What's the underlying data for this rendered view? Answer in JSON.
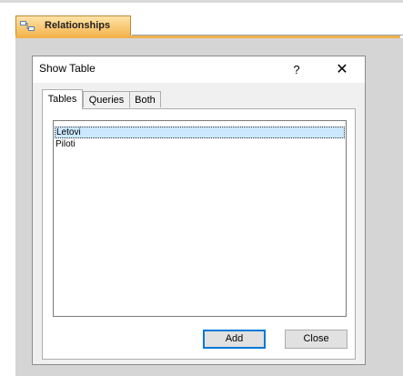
{
  "app_tab": {
    "label": "Relationships",
    "icon": "relationships-icon"
  },
  "dialog": {
    "title": "Show Table",
    "help_label": "?",
    "close_label": "✕",
    "tabs": [
      {
        "label": "Tables",
        "active": true
      },
      {
        "label": "Queries",
        "active": false
      },
      {
        "label": "Both",
        "active": false
      }
    ],
    "list_items": [
      {
        "label": "Letovi",
        "selected": true
      },
      {
        "label": "Piloti",
        "selected": false
      }
    ],
    "buttons": {
      "add": "Add",
      "close": "Close"
    }
  },
  "colors": {
    "accent_tab": "#f4b54f",
    "selection": "#cce8ff",
    "workspace": "#d5d5d5"
  }
}
